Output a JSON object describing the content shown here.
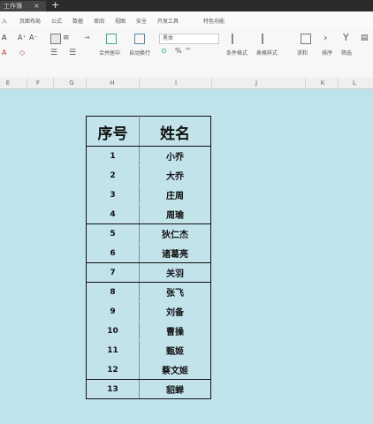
{
  "tabbar": {
    "tab_label": "工作簿",
    "close": "×",
    "new_tab": "+"
  },
  "menu": [
    "入",
    "页面布局",
    "公式",
    "数据",
    "审阅",
    "视图",
    "安全",
    "开发工具",
    "特色功能"
  ],
  "ribbon": {
    "font_name": "黑体",
    "merge_label": "合并居中",
    "wrap_label": "自动换行",
    "percent": "%",
    "cond_format": "条件格式",
    "table_style": "表格样式",
    "sum_label": "求和",
    "filter_label": "筛选",
    "sort_label": "排序"
  },
  "columns": [
    "E",
    "F",
    "G",
    "H",
    "I",
    "J",
    "K",
    "L"
  ],
  "table": {
    "header": {
      "num": "序号",
      "name": "姓名"
    },
    "rows": [
      {
        "num": "1",
        "name": "小乔"
      },
      {
        "num": "2",
        "name": "大乔"
      },
      {
        "num": "3",
        "name": "庄周"
      },
      {
        "num": "4",
        "name": "周瑜"
      },
      {
        "num": "5",
        "name": "狄仁杰"
      },
      {
        "num": "6",
        "name": "诸葛亮"
      },
      {
        "num": "7",
        "name": "关羽"
      },
      {
        "num": "8",
        "name": "张飞"
      },
      {
        "num": "9",
        "name": "刘备"
      },
      {
        "num": "10",
        "name": "曹操"
      },
      {
        "num": "11",
        "name": "甄姬"
      },
      {
        "num": "12",
        "name": "蔡文姬"
      },
      {
        "num": "13",
        "name": "貂蝉"
      }
    ]
  },
  "colors": {
    "sheet_bg": "#bfe3ea",
    "border": "#111111"
  }
}
